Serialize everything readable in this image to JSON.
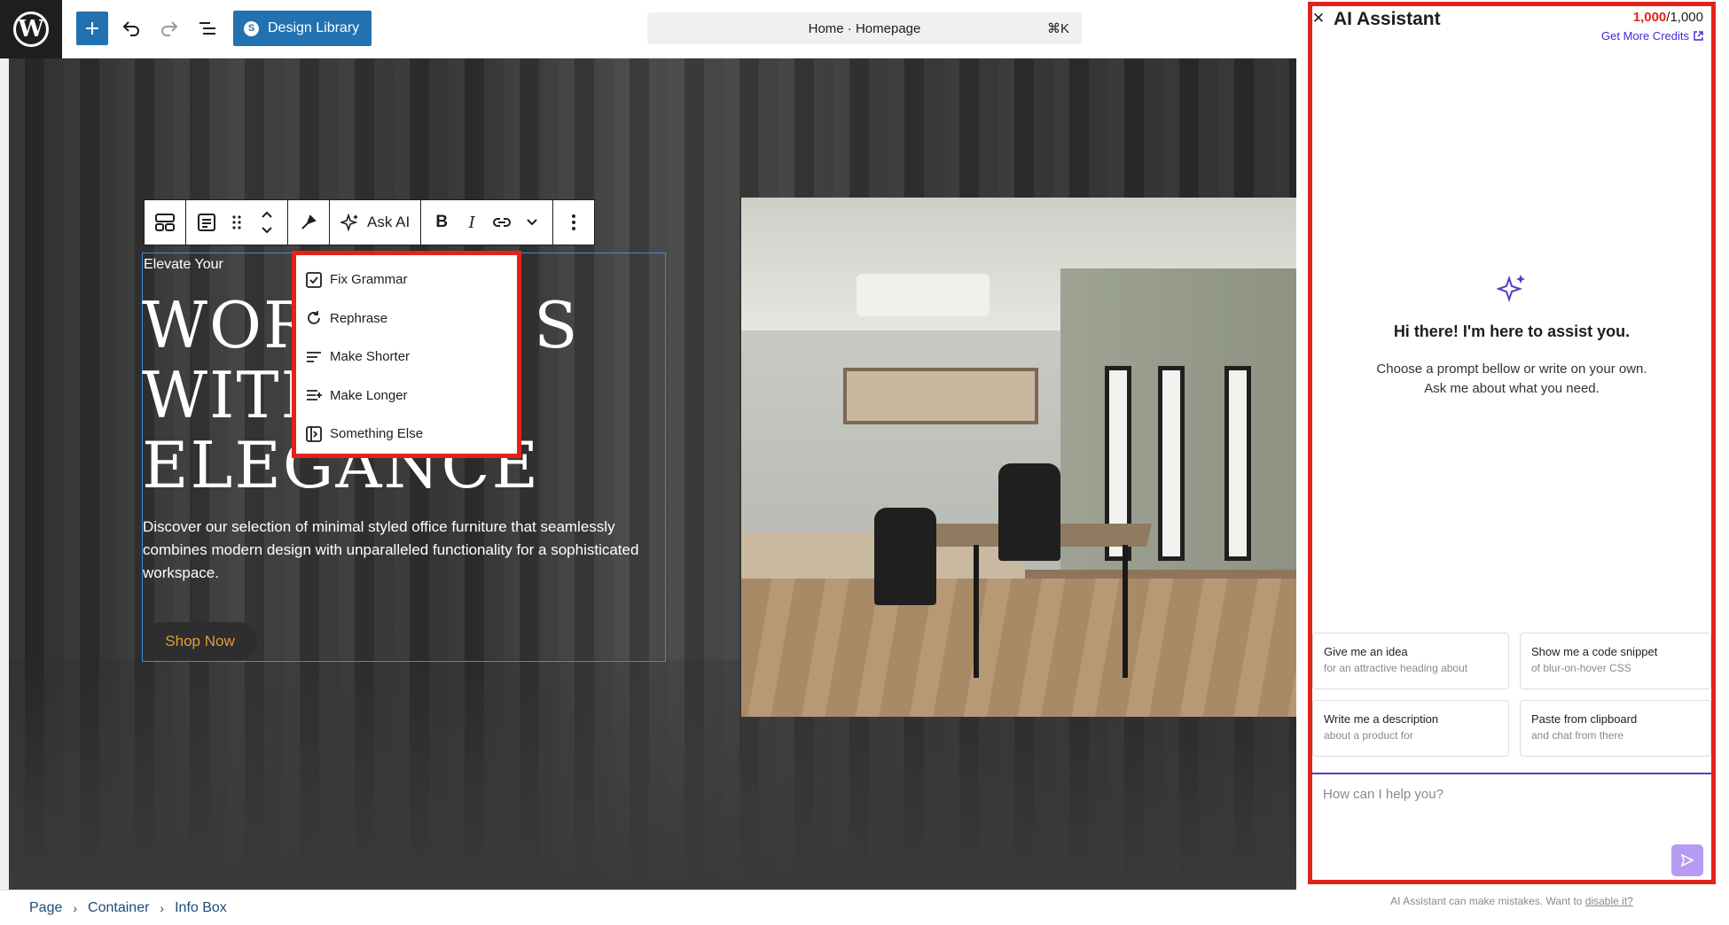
{
  "topbar": {
    "logo_letter": "W",
    "design_library_label": "Design Library",
    "command_title": "Home · Homepage",
    "command_shortcut": "⌘K"
  },
  "block_toolbar": {
    "ask_ai_label": "Ask AI",
    "bold_label": "B",
    "italic_label": "I"
  },
  "hero": {
    "eyebrow": "Elevate Your",
    "title_line1": "WOR          S",
    "title_line2": "WITH",
    "title_line3": "ELEGANCE",
    "description": "Discover our selection of minimal styled office furniture that seamlessly combines modern design with unparalleled functionality for a sophisticated workspace.",
    "button_label": "Shop Now",
    "button_text_color": "#e39b3a"
  },
  "ai_menu": {
    "items": [
      {
        "label": "Fix Grammar",
        "icon": "checklist-icon"
      },
      {
        "label": "Rephrase",
        "icon": "refresh-icon"
      },
      {
        "label": "Make Shorter",
        "icon": "shorten-icon"
      },
      {
        "label": "Make Longer",
        "icon": "lengthen-icon"
      },
      {
        "label": "Something Else",
        "icon": "panel-icon"
      }
    ]
  },
  "breadcrumbs": [
    "Page",
    "Container",
    "Info Box"
  ],
  "assistant": {
    "title": "AI Assistant",
    "credits_used": "1,000",
    "credits_total": "/1,000",
    "get_credits_label": "Get More Credits",
    "welcome_title": "Hi there! I'm here to assist you.",
    "welcome_line1": "Choose a prompt bellow or write on your own.",
    "welcome_line2": "Ask me about what you need.",
    "prompts": [
      {
        "title": "Give me an idea",
        "subtitle": "for an attractive heading about"
      },
      {
        "title": "Show me a code snippet",
        "subtitle": "of blur-on-hover CSS"
      },
      {
        "title": "Write me a description",
        "subtitle": "about a product for"
      },
      {
        "title": "Paste from clipboard",
        "subtitle": "and chat from there"
      }
    ],
    "input_placeholder": "How can I help you?",
    "disclaimer_text": "AI Assistant can make mistakes. Want to",
    "disclaimer_link": "disable it?",
    "accent_color": "#5b3cc4",
    "highlight_color": "#e3231a"
  }
}
